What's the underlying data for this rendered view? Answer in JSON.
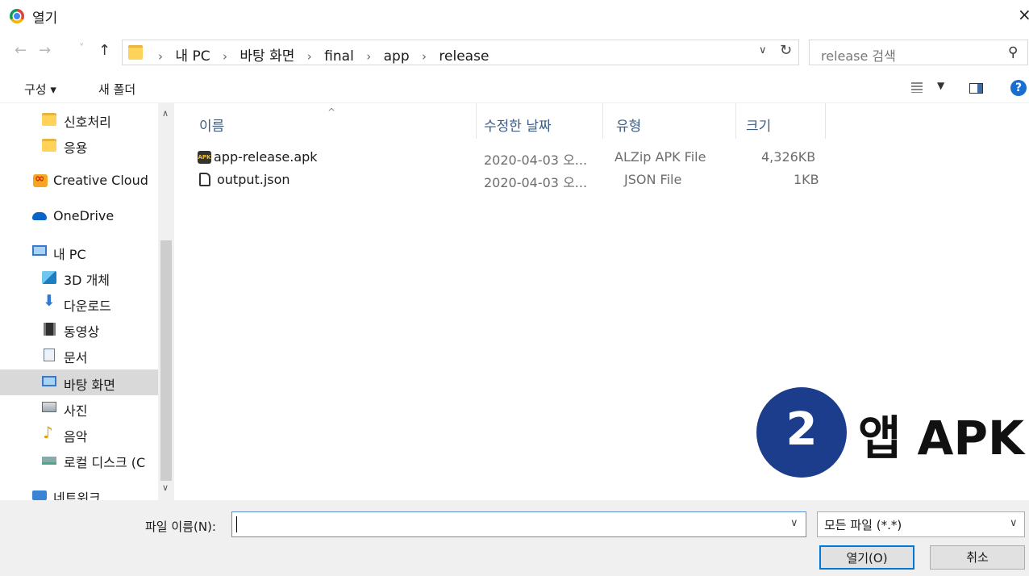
{
  "window": {
    "title": "열기",
    "close": "×"
  },
  "nav": {
    "back": "←",
    "forward": "→",
    "recent": "˅",
    "up": "↑",
    "breadcrumb_sep": "›",
    "breadcrumbs": [
      "내 PC",
      "바탕 화면",
      "final",
      "app",
      "release"
    ],
    "refresh": "↻",
    "search_placeholder": "release 검색"
  },
  "command_bar": {
    "organize": "구성 ▾",
    "new_folder": "새 폴더",
    "help": "?"
  },
  "sidebar": {
    "items": [
      {
        "label": "신호처리",
        "icon": "folder-icon"
      },
      {
        "label": "응용",
        "icon": "folder-icon"
      },
      {
        "label": "Creative Cloud",
        "icon": "creative-cloud-icon"
      },
      {
        "label": "OneDrive",
        "icon": "onedrive-cloud-icon"
      },
      {
        "label": "내 PC",
        "icon": "pc-icon"
      },
      {
        "label": "3D 개체",
        "icon": "3d-objects-icon"
      },
      {
        "label": "다운로드",
        "icon": "download-icon"
      },
      {
        "label": "동영상",
        "icon": "video-icon"
      },
      {
        "label": "문서",
        "icon": "document-icon"
      },
      {
        "label": "바탕 화면",
        "icon": "desktop-icon",
        "selected": true
      },
      {
        "label": "사진",
        "icon": "pictures-icon"
      },
      {
        "label": "음악",
        "icon": "music-icon"
      },
      {
        "label": "로컬 디스크 (C",
        "icon": "disk-icon"
      },
      {
        "label": "네트워크",
        "icon": "network-icon"
      }
    ]
  },
  "file_list": {
    "columns": [
      "이름",
      "수정한 날짜",
      "유형",
      "크기"
    ],
    "rows": [
      {
        "name": "app-release.apk",
        "modified": "2020-04-03 오...",
        "type": "ALZip APK File",
        "size": "4,326KB",
        "icon": "apk-file-icon"
      },
      {
        "name": "output.json",
        "modified": "2020-04-03 오...",
        "type": "JSON File",
        "size": "1KB",
        "icon": "json-file-icon"
      }
    ]
  },
  "bottom": {
    "filename_label": "파일 이름(N):",
    "filename_value": "",
    "filetype_value": "모든 파일 (*.*)",
    "open_button": "열기(O)",
    "cancel_button": "취소"
  },
  "overlay": {
    "step_number": "2",
    "caption": "앱 APK"
  },
  "colors": {
    "accent": "#0078d7",
    "badge": "#1c3d8c",
    "selected_row": "#d9d9d9"
  }
}
